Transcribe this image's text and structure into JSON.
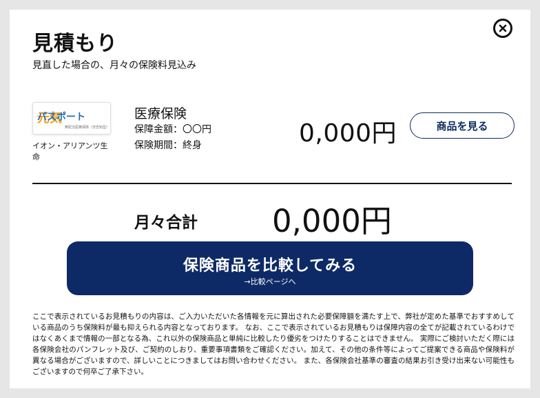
{
  "header": {
    "title": "見積もり",
    "subtitle": "見直した場合の、月々の保険料見込み"
  },
  "product": {
    "logo_main": "元気",
    "logo_sub": "パスポート",
    "logo_tagline": "無配当医療保険（非告知型）",
    "company_name": "イオン・アリアンツ生命",
    "name": "医療保険",
    "coverage_amount": "保障金額：〇〇円",
    "coverage_period": "保険期間：終身",
    "price": "0,000円",
    "view_button_label": "商品を見る"
  },
  "total": {
    "label": "月々合計",
    "price": "0,000円"
  },
  "compare_button": {
    "label": "保険商品を比較してみる",
    "sublabel": "→比較ページへ"
  },
  "disclaimer": "ここで表示されているお見積もりの内容は、ご入力いただいた各情報を元に算出された必要保障額を満たす上で、弊社が定めた基準でおすすめしている商品のうち保険料が最も抑えられる内容となっております。 なお、ここで表示されているお見積もりは保障内容の全てが記載されているわけではなくあくまで情報の一部となる為、これ以外の保険商品と単純に比較したり優劣をつけたりすることはできません。 実際にご検討いただく際には各保険会社のパンフレット及び、ご契約のしおり、重要事項書類をご確認ください。加えて、その他の条件等によってご提案できる商品や保険料が異なる場合がございますので、詳しいことにつきましてはお問い合わせください。 また、各保険会社基準の審査の結果お引き受け出来ない可能性もございますので何卒ご了承下さい。",
  "icons": {
    "close": "close-circle-icon"
  },
  "colors": {
    "primary_navy": "#0e2a66",
    "logo_orange": "#f0a020",
    "logo_blue": "#1f6fb5"
  }
}
